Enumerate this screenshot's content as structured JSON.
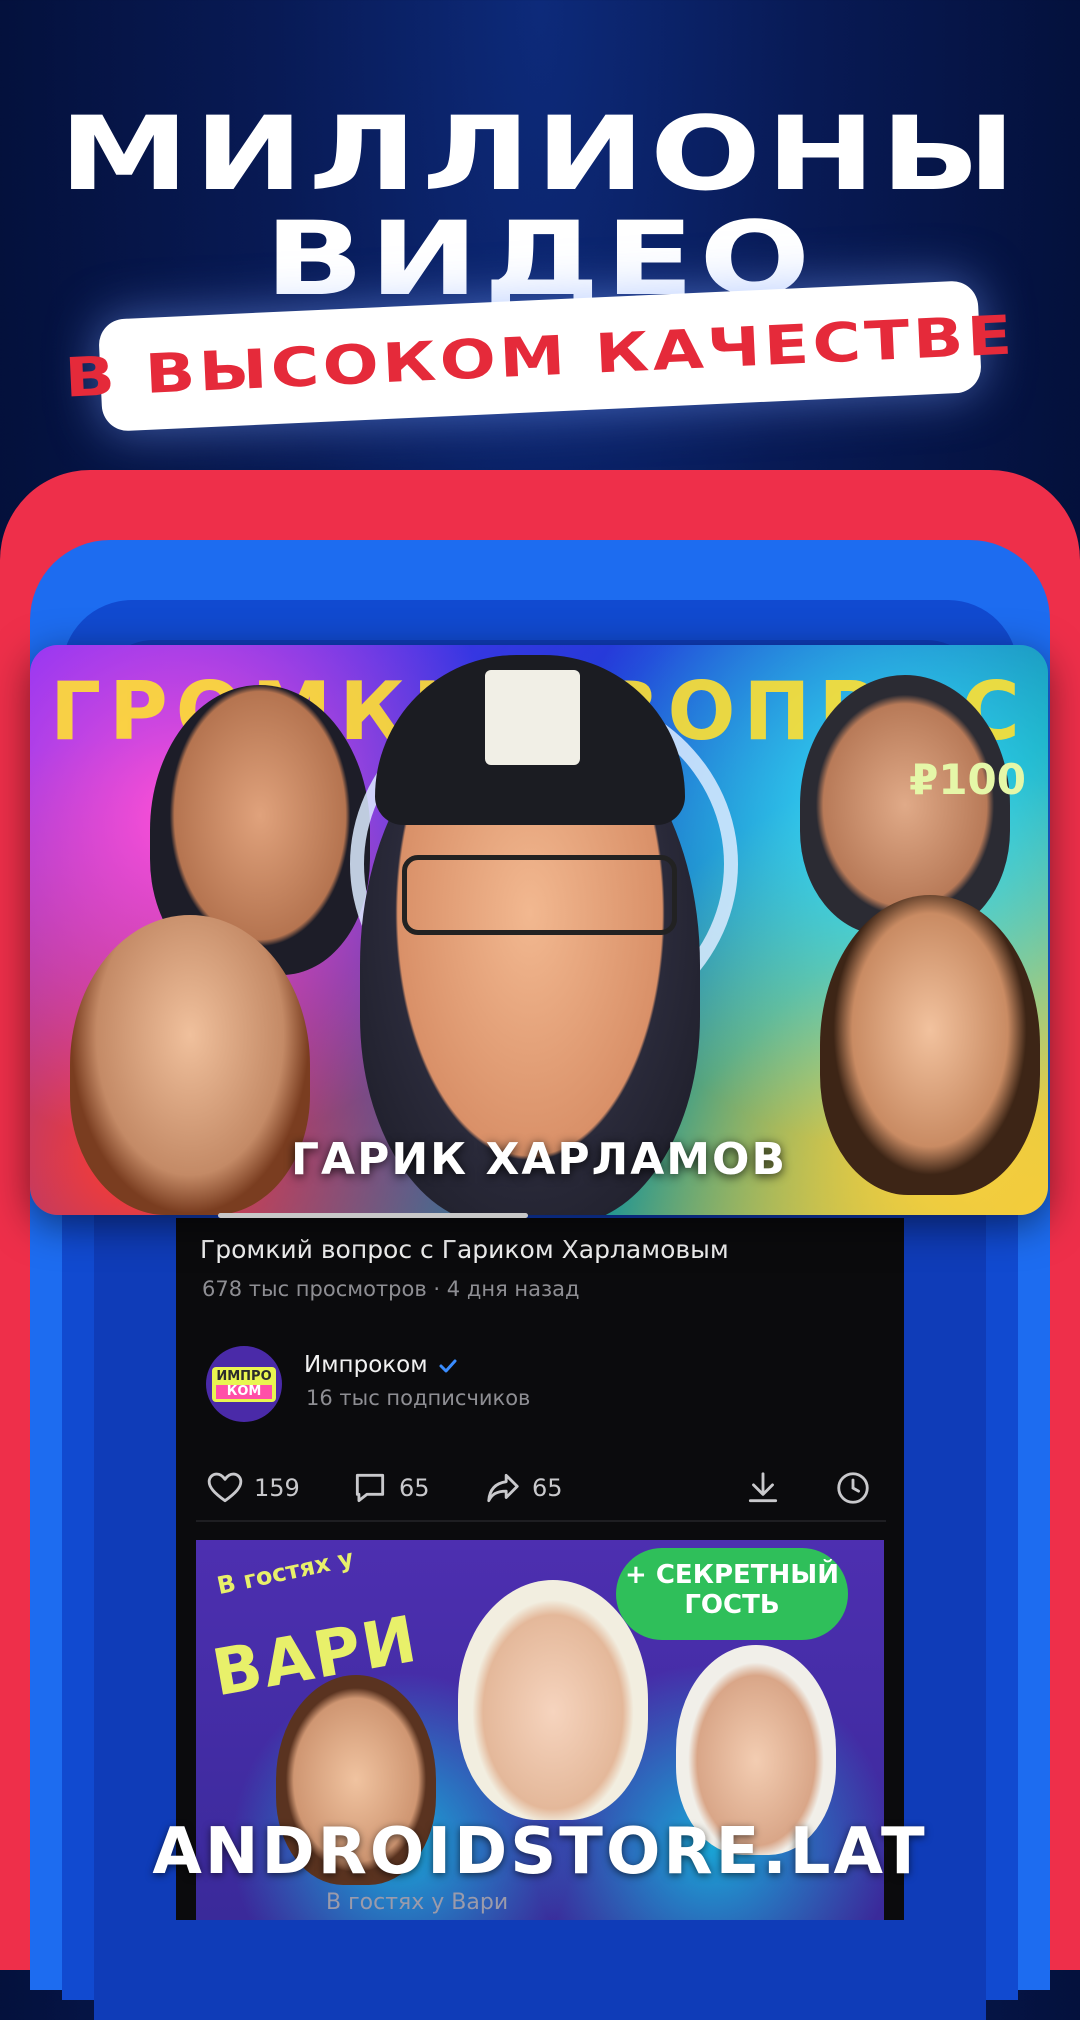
{
  "promo": {
    "headline_line1": "МИЛЛИОНЫ",
    "headline_line2": "ВИДЕО",
    "subheadline": "В ВЫСОКОМ КАЧЕСТВЕ"
  },
  "featured_video": {
    "thumbnail_text_top": "ГРОМКИЙ ВОПРОС",
    "thumbnail_price": "₽100",
    "thumbnail_name": "ГАРИК ХАРЛАМОВ",
    "progress": 0.33,
    "title": "Громкий вопрос с Гариком Харламовым",
    "views": "678 тыс просмотров",
    "separator": "·",
    "uploaded": "4 дня назад",
    "channel": {
      "name": "Импроком",
      "logo_line1": "ИМПРО",
      "logo_line2": "КОМ",
      "subscribers": "16 тыс подписчиков",
      "verified": true
    },
    "actions": {
      "likes": "159",
      "comments": "65",
      "shares": "65"
    }
  },
  "next_video": {
    "thumbnail_guest": "В гостях у",
    "thumbnail_name": "ВАРИ",
    "thumbnail_badge": "+ СЕКРЕТНЫЙ ГОСТЬ",
    "title_partial": "В гостях у Вари"
  },
  "watermark": "ANDROIDSTORE.LAT",
  "colors": {
    "background": "#081a55",
    "accent_red": "#e52a3a",
    "accent_blue": "#1d6cf0",
    "frame_red": "#ee2f4a",
    "panel_bg": "#0b0b0d"
  }
}
